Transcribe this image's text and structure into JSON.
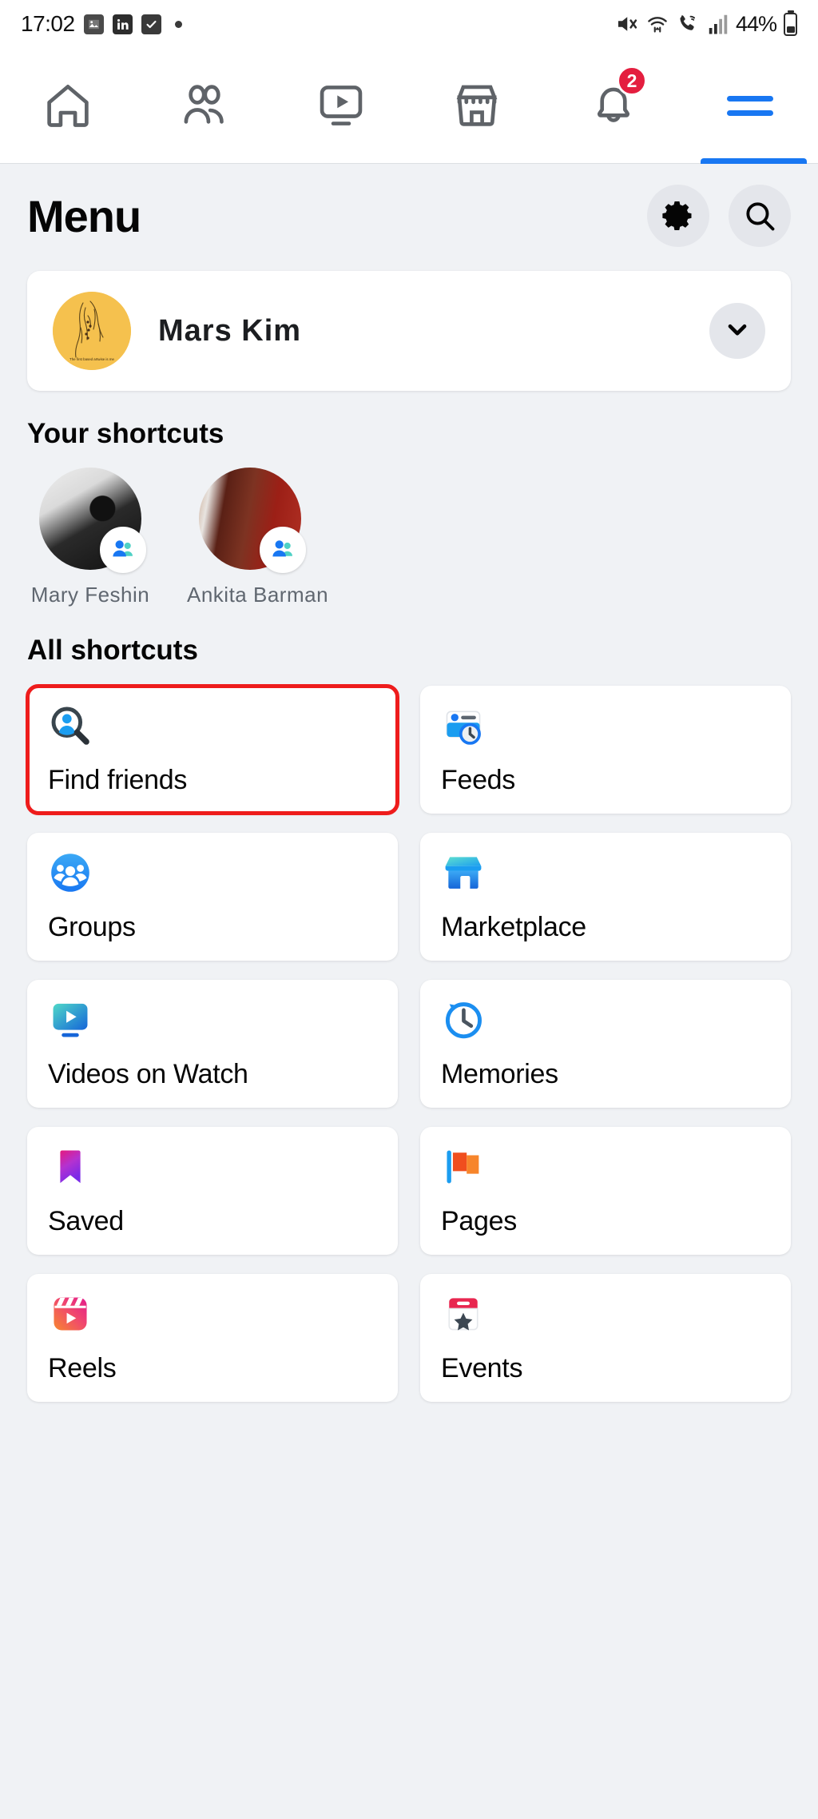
{
  "statusbar": {
    "time": "17:02",
    "app_icons": [
      "photos-icon",
      "linkedin-icon",
      "tasks-icon",
      "dot-indicator"
    ],
    "mute_icon": "mute-icon",
    "wifi_icon": "wifi-icon",
    "call_icon": "call-wifi-icon",
    "signal_icon": "signal-bars-icon",
    "battery_percent": "44%"
  },
  "topnav": {
    "tabs": [
      {
        "name": "home",
        "icon": "home-icon",
        "active": false,
        "badge": ""
      },
      {
        "name": "friends",
        "icon": "friends-icon",
        "active": false,
        "badge": ""
      },
      {
        "name": "video",
        "icon": "video-icon",
        "active": false,
        "badge": ""
      },
      {
        "name": "marketplace",
        "icon": "marketplace-icon",
        "active": false,
        "badge": ""
      },
      {
        "name": "notifications",
        "icon": "bell-icon",
        "active": false,
        "badge": "2"
      },
      {
        "name": "menu",
        "icon": "hamburger-icon",
        "active": true,
        "badge": ""
      }
    ]
  },
  "header": {
    "title": "Menu",
    "settings_icon": "gear-icon",
    "search_icon": "search-icon"
  },
  "profile": {
    "name": "Mars Kim",
    "avatar": "user-avatar",
    "expand_icon": "chevron-down-icon"
  },
  "your_shortcuts": {
    "label": "Your shortcuts",
    "items": [
      {
        "name": "Mary Feshin",
        "badge": "group-badge-icon"
      },
      {
        "name": "Ankita Barman",
        "badge": "group-badge-icon"
      }
    ]
  },
  "all_shortcuts": {
    "label": "All shortcuts",
    "tiles": [
      {
        "label": "Find friends",
        "icon": "find-friends-icon",
        "highlighted": true
      },
      {
        "label": "Feeds",
        "icon": "feeds-icon",
        "highlighted": false
      },
      {
        "label": "Groups",
        "icon": "groups-icon",
        "highlighted": false
      },
      {
        "label": "Marketplace",
        "icon": "marketplace-icon",
        "highlighted": false
      },
      {
        "label": "Videos on Watch",
        "icon": "video-watch-icon",
        "highlighted": false
      },
      {
        "label": "Memories",
        "icon": "memories-icon",
        "highlighted": false
      },
      {
        "label": "Saved",
        "icon": "bookmark-icon",
        "highlighted": false
      },
      {
        "label": "Pages",
        "icon": "flag-icon",
        "highlighted": false
      },
      {
        "label": "Reels",
        "icon": "reels-icon",
        "highlighted": false
      },
      {
        "label": "Events",
        "icon": "calendar-star-icon",
        "highlighted": false
      }
    ]
  },
  "colors": {
    "brand_blue": "#1877f2",
    "badge_red": "#e41e3f",
    "highlight_red": "#ee1c1c",
    "page_bg": "#f0f2f5",
    "card_bg": "#ffffff"
  }
}
